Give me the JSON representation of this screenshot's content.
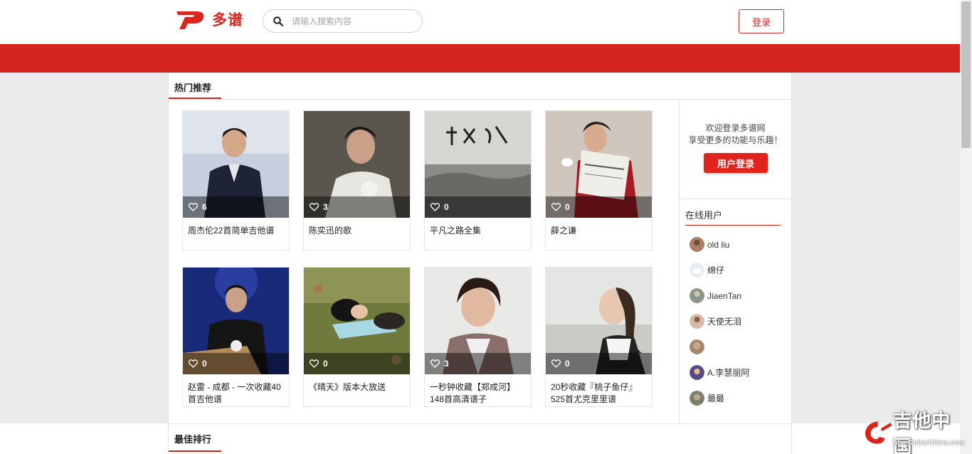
{
  "header": {
    "logo_text": "多谱",
    "search_placeholder": "请输入搜索内容",
    "login_label": "登录"
  },
  "hot": {
    "title": "热门推荐",
    "cards": [
      {
        "likes": "6",
        "title": "周杰伦22首简单吉他谱"
      },
      {
        "likes": "3",
        "title": "陈奕迅的歌"
      },
      {
        "likes": "0",
        "title": "平凡之路全集"
      },
      {
        "likes": "0",
        "title": "薛之谦"
      },
      {
        "likes": "0",
        "title": "赵雷 - 成都 - 一次收藏40首吉他谱"
      },
      {
        "likes": "0",
        "title": "《晴天》版本大放送"
      },
      {
        "likes": "3",
        "title": "一秒钟收藏【郑成河】148首高清谱子"
      },
      {
        "likes": "0",
        "title": "20秒收藏『桃子鱼仔』525首尤克里里谱"
      }
    ]
  },
  "sidebar": {
    "welcome_line1": "欢迎登录多谱网",
    "welcome_line2": "享受更多的功能与乐趣！",
    "user_login_label": "用户登录",
    "online_title": "在线用户",
    "users": [
      {
        "name": "old liu"
      },
      {
        "name": "绵仔"
      },
      {
        "name": "JiaenTan"
      },
      {
        "name": "天使无泪"
      },
      {
        "name": ""
      },
      {
        "name": "A.李慧丽阿"
      },
      {
        "name": "最最"
      }
    ]
  },
  "best": {
    "title": "最佳排行"
  },
  "watermark": {
    "text": "吉他中国",
    "sub": "bbs.GuitarChina.com"
  },
  "colors": {
    "brand_red": "#d2241c"
  }
}
